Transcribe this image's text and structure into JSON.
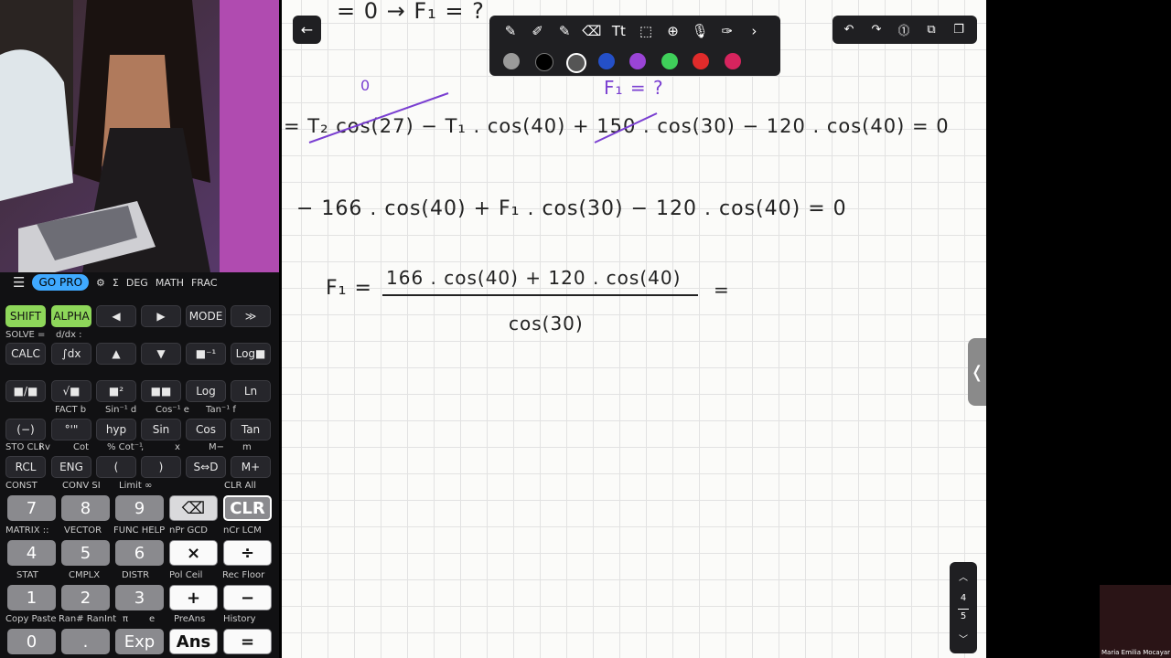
{
  "webcam": {
    "name_label": "Maria Emilia Mocayar Blanco"
  },
  "calculator": {
    "topbar": {
      "menu": "☰",
      "gopro": "GO PRO",
      "gear": "⚙",
      "sigma": "Σ",
      "deg": "DEG",
      "math": "MATH",
      "frac": "FRAC"
    },
    "row1": [
      "SHIFT",
      "ALPHA",
      "◀",
      "▶",
      "MODE",
      "≫"
    ],
    "row1_sub": [
      "SOLVE =",
      "d/dx :"
    ],
    "row2": [
      "CALC",
      "∫dx",
      "▲",
      "▼",
      "■⁻¹",
      "Log■"
    ],
    "row3": [
      "■/■",
      "√■",
      "■²",
      "■■",
      "Log",
      "Ln"
    ],
    "row3_sub": [
      "FACT b",
      "Sin⁻¹ d",
      "Cos⁻¹ e",
      "Tan⁻¹ f"
    ],
    "row4": [
      "(−)",
      "°'\"",
      "hyp",
      "Sin",
      "Cos",
      "Tan"
    ],
    "row4_sub": [
      "STO CLRv",
      "i",
      "Cot",
      "% Cot⁻¹",
      ",",
      "x",
      "M−",
      "m"
    ],
    "row5": [
      "RCL",
      "ENG",
      "(",
      ")",
      "S⇔D",
      "M+"
    ],
    "row5_sub": [
      "CONST",
      "CONV SI",
      "Limit ∞",
      "CLR All"
    ],
    "row6": [
      "7",
      "8",
      "9",
      "⌫",
      "CLR"
    ],
    "row6_sub": [
      "MATRIX ::",
      "VECTOR",
      "FUNC HELP",
      "nPr GCD",
      "nCr LCM"
    ],
    "row7": [
      "4",
      "5",
      "6",
      "×",
      "÷"
    ],
    "row7_sub": [
      "STAT",
      "CMPLX",
      "DISTR",
      "Pol Ceil",
      "Rec Floor"
    ],
    "row8": [
      "1",
      "2",
      "3",
      "+",
      "−"
    ],
    "row8_sub": [
      "Copy Paste",
      "Ran# RanInt",
      "π",
      "e",
      "PreAns",
      "History"
    ],
    "row9": [
      "0",
      ".",
      "Exp",
      "Ans",
      "="
    ]
  },
  "toolbar": {
    "back": "←",
    "tools": [
      "✎",
      "✐",
      "✎",
      "⌫",
      "Tt",
      "⬚",
      "⊕",
      "🎙",
      "✑",
      "›"
    ],
    "colors": [
      "#9a9a9a",
      "#000000",
      "#ffffff",
      "#2450c8",
      "#9a44d6",
      "#3fcf5a",
      "#e02b2b",
      "#d6245e"
    ]
  },
  "right_tools": [
    "↶",
    "↷",
    "⓵",
    "⧉",
    "❐"
  ],
  "pager": {
    "up": "︿",
    "current": "4",
    "total": "5",
    "down": "﹀"
  },
  "board": {
    "line0": "= 0   →   F₁ = ?",
    "zero": "0",
    "f1q": "F₁ = ?",
    "line1": "= T₂ cos(27) − T₁ . cos(40) + 150 . cos(30) − 120 . cos(40) = 0",
    "line2": "− 166 . cos(40) + F₁ . cos(30) − 120 . cos(40) = 0",
    "f1": "F₁ =",
    "num": "166 . cos(40) + 120 . cos(40)",
    "den": "cos(30)",
    "eq": "="
  },
  "handle": "❬",
  "mini_label": "Maria Emilia Mocayar"
}
